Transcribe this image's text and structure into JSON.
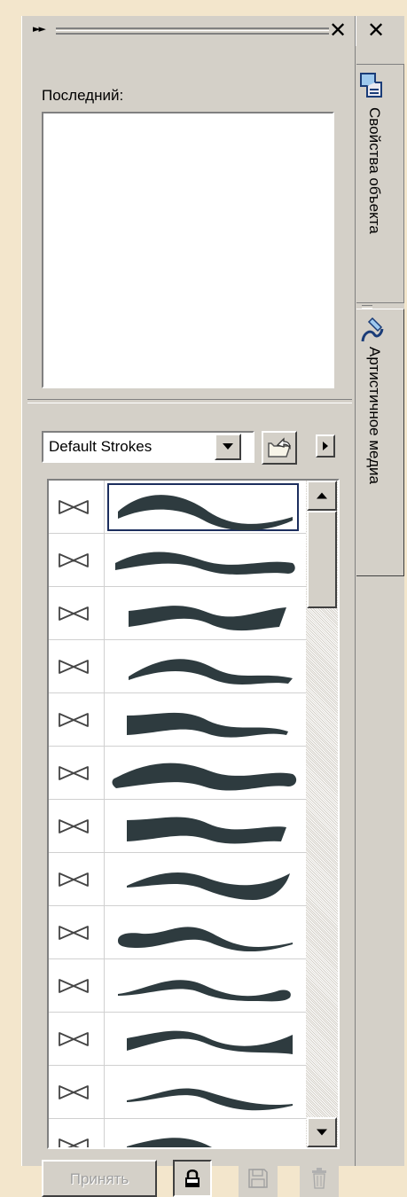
{
  "titlebar": {
    "grip_icon": "double-arrow-icon",
    "close_symbol": "✕",
    "close_icon": "close-icon"
  },
  "recent": {
    "label": "Последний:"
  },
  "library": {
    "selected": "Default Strokes",
    "options_visible": [
      "Default Strokes"
    ],
    "open_icon": "open-folder-icon",
    "flyout_icon": "flyout-arrow-icon"
  },
  "strokes": {
    "row_icon": "bowtie-icon",
    "selected_index": 0,
    "items": [
      {
        "id": "stroke-1"
      },
      {
        "id": "stroke-2"
      },
      {
        "id": "stroke-3"
      },
      {
        "id": "stroke-4"
      },
      {
        "id": "stroke-5"
      },
      {
        "id": "stroke-6"
      },
      {
        "id": "stroke-7"
      },
      {
        "id": "stroke-8"
      },
      {
        "id": "stroke-9"
      },
      {
        "id": "stroke-10"
      },
      {
        "id": "stroke-11"
      },
      {
        "id": "stroke-12"
      },
      {
        "id": "stroke-13"
      }
    ],
    "stroke_color": "#2e3b3f"
  },
  "footer": {
    "apply_label": "Принять",
    "lock_icon": "lock-icon",
    "save_icon": "save-icon",
    "delete_icon": "trash-icon"
  },
  "tabs": [
    {
      "label": "Свойства объекта",
      "icon": "object-properties-icon",
      "active": false
    },
    {
      "label": "Артистичное медиа",
      "icon": "artistic-media-icon",
      "active": true
    }
  ],
  "colors": {
    "panel": "#d4d0c8",
    "background": "#f3e6cc",
    "selection_border": "#1c2e5e"
  }
}
